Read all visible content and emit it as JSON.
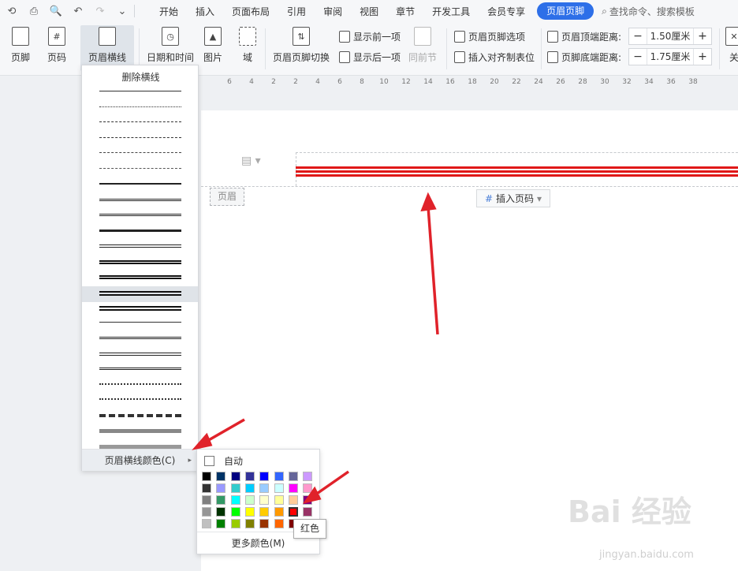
{
  "menu": {
    "items": [
      "开始",
      "插入",
      "页面布局",
      "引用",
      "审阅",
      "视图",
      "章节",
      "开发工具",
      "会员专享"
    ],
    "active": "页眉页脚",
    "search": "查找命令、搜索模板"
  },
  "toolbar": {
    "footer": "页脚",
    "page_num": "页码",
    "header_line": "页眉横线",
    "datetime": "日期和时间",
    "picture": "图片",
    "field": "域",
    "switch": "页眉页脚切换",
    "show_prev": "显示前一项",
    "show_next": "显示后一项",
    "same_prev": "同前节",
    "options": "页眉页脚选项",
    "insert_tab": "插入对齐制表位",
    "top_dist_label": "页眉顶端距离:",
    "top_dist_value": "1.50厘米",
    "bottom_dist_label": "页脚底端距离:",
    "bottom_dist_value": "1.75厘米",
    "close": "关"
  },
  "ruler": [
    "6",
    "4",
    "2",
    "2",
    "4",
    "6",
    "8",
    "10",
    "12",
    "14",
    "16",
    "18",
    "20",
    "22",
    "24",
    "26",
    "28",
    "30",
    "32",
    "34",
    "36",
    "38"
  ],
  "document": {
    "header_tag": "页眉",
    "insert_page_number": "插入页码"
  },
  "dropdown": {
    "delete_line": "删除横线",
    "line_color": "页眉横线颜色(C)"
  },
  "palette": {
    "auto": "自动",
    "more_colors": "更多颜色(M)",
    "tooltip": "红色",
    "colors": [
      [
        "#000000",
        "#003366",
        "#000080",
        "#333399",
        "#0000ff",
        "#3366ff",
        "#666699",
        "#cc99ff"
      ],
      [
        "#333333",
        "#9999ff",
        "#33cccc",
        "#00ccff",
        "#99ccff",
        "#ccffff",
        "#ff00ff",
        "#ff99cc"
      ],
      [
        "#808080",
        "#339966",
        "#00ffff",
        "#ccffcc",
        "#ffffcc",
        "#ffff99",
        "#ffcc99",
        "#800080"
      ],
      [
        "#969696",
        "#003300",
        "#00ff00",
        "#ffff00",
        "#ffcc00",
        "#ff9900",
        "#ff0000",
        "#993366"
      ],
      [
        "#c0c0c0",
        "#008000",
        "#99cc00",
        "#808000",
        "#993300",
        "#ff6600",
        "#800000",
        "#ffffff"
      ]
    ]
  },
  "watermark": {
    "logo": "Bai 经验",
    "url": "jingyan.baidu.com"
  }
}
